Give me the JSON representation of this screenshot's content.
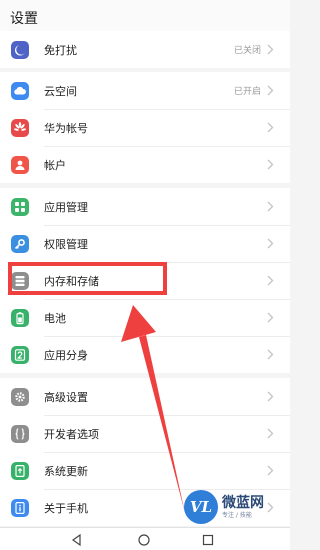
{
  "header": {
    "title": "设置"
  },
  "colors": {
    "accent": "#ef4040",
    "chevron": "#c4c4c4"
  },
  "groups": [
    {
      "items": [
        {
          "label": "免打扰",
          "status": "已关闭",
          "icon": "moon-icon",
          "icon_bg": "#4f63c7"
        }
      ]
    },
    {
      "items": [
        {
          "label": "云空间",
          "status": "已开启",
          "icon": "cloud-icon",
          "icon_bg": "#3d8bf0"
        },
        {
          "label": "华为帐号",
          "status": "",
          "icon": "huawei-logo-icon",
          "icon_bg": "#e74a4a"
        },
        {
          "label": "帐户",
          "status": "",
          "icon": "user-icon",
          "icon_bg": "#f0554a"
        }
      ]
    },
    {
      "items": [
        {
          "label": "应用管理",
          "status": "",
          "icon": "apps-grid-icon",
          "icon_bg": "#3cb56a"
        },
        {
          "label": "权限管理",
          "status": "",
          "icon": "key-icon",
          "icon_bg": "#3a8fe0"
        },
        {
          "label": "内存和存储",
          "status": "",
          "icon": "storage-icon",
          "icon_bg": "#8e8e8e"
        },
        {
          "label": "电池",
          "status": "",
          "icon": "battery-icon",
          "icon_bg": "#38b26a"
        },
        {
          "label": "应用分身",
          "status": "",
          "icon": "app-twin-icon",
          "icon_bg": "#38b26a"
        }
      ]
    },
    {
      "items": [
        {
          "label": "高级设置",
          "status": "",
          "icon": "gear-icon",
          "icon_bg": "#8e8e8e"
        },
        {
          "label": "开发者选项",
          "status": "",
          "icon": "braces-icon",
          "icon_bg": "#8e8e8e"
        },
        {
          "label": "系统更新",
          "status": "",
          "icon": "system-update-icon",
          "icon_bg": "#38b26a"
        },
        {
          "label": "关于手机",
          "status": "",
          "icon": "info-icon",
          "icon_bg": "#3d8bf0"
        }
      ]
    }
  ],
  "watermark": {
    "logo": "VL",
    "name": "微蓝网",
    "sub": "专注 / 技能"
  }
}
